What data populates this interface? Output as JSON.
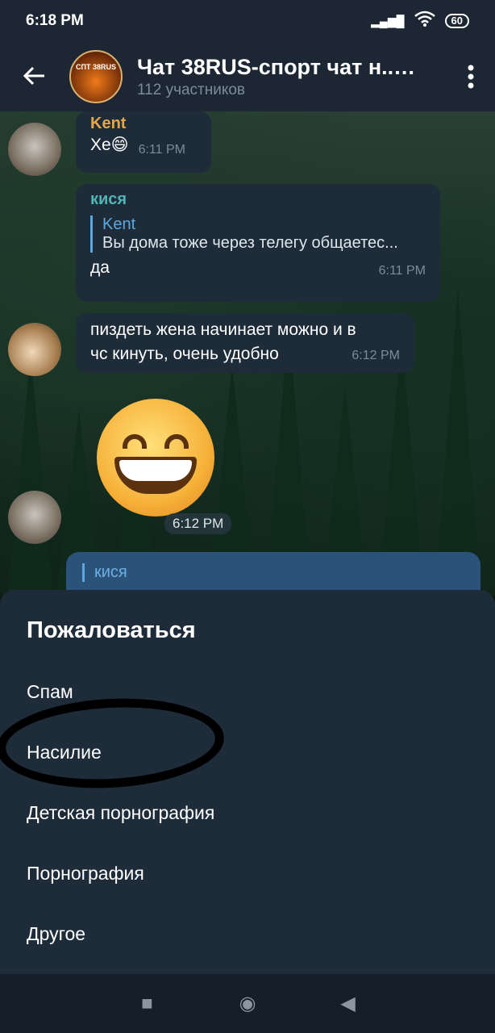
{
  "status_bar": {
    "time": "6:18 PM",
    "signal": "▂▄▆█",
    "wifi": "wifi",
    "battery": "60"
  },
  "header": {
    "back_icon": "back-arrow-icon",
    "avatar_text": "СПТ 38RUS",
    "title": "Чат 38RUS-спорт чат н...",
    "subtitle": "112 участников",
    "mute_icon": "muted-speaker-icon",
    "menu_icon": "more-vertical-icon"
  },
  "messages": {
    "m1": {
      "sender": "Kent",
      "text": "Хе😄",
      "time": "6:11 PM"
    },
    "m2": {
      "sender": "кися",
      "reply_name": "Kent",
      "reply_text": "Вы дома тоже через телегу общаетес...",
      "text": "да",
      "time": "6:11 PM"
    },
    "m3": {
      "line1": "пиздеть жена начинает можно и в",
      "line2": "чс кинуть, очень удобно",
      "time": "6:12 PM"
    },
    "m4": {
      "emoji": "😁",
      "time": "6:12 PM"
    },
    "m5": {
      "reply_name": "кися"
    }
  },
  "report_sheet": {
    "title": "Пожаловаться",
    "options": [
      "Спам",
      "Насилие",
      "Детская порнография",
      "Порнография",
      "Другое"
    ]
  },
  "navbar": {
    "recents": "■",
    "home": "◉",
    "back": "◀"
  }
}
